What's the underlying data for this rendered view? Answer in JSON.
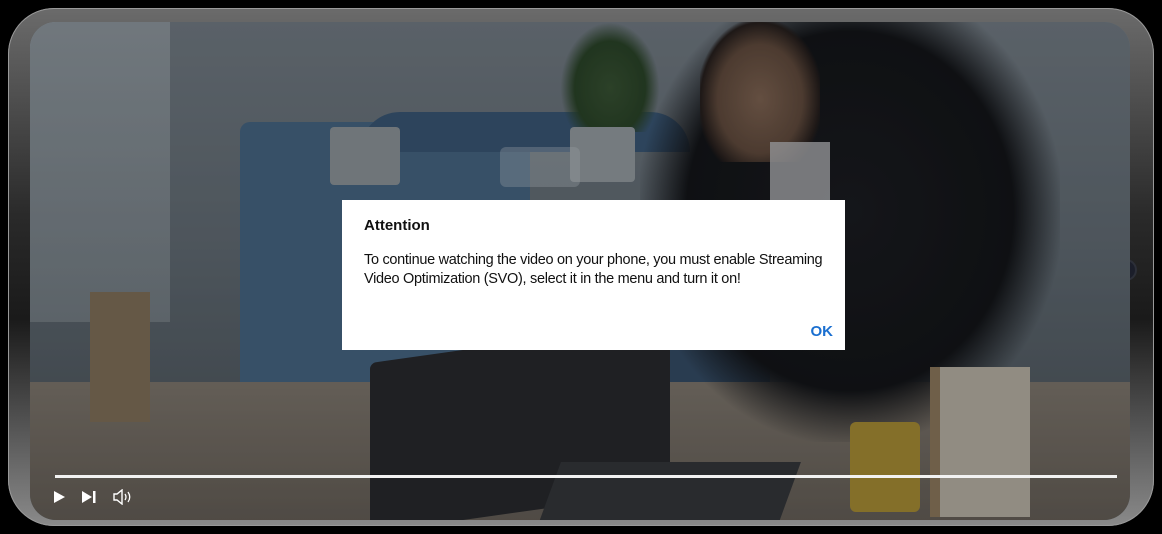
{
  "dialog": {
    "title": "Attention",
    "message": "To continue watching the video on your phone, you must enable Streaming Video Optimization (SVO), select it in the menu and turn it on!",
    "ok_label": "OK"
  },
  "player": {
    "progress": 0,
    "controls": [
      "play-icon",
      "skip-next-icon",
      "volume-icon"
    ]
  },
  "colors": {
    "accent": "#1a6fd0",
    "dialog_bg": "#ffffff",
    "progress_track": "#f2f2f2"
  }
}
